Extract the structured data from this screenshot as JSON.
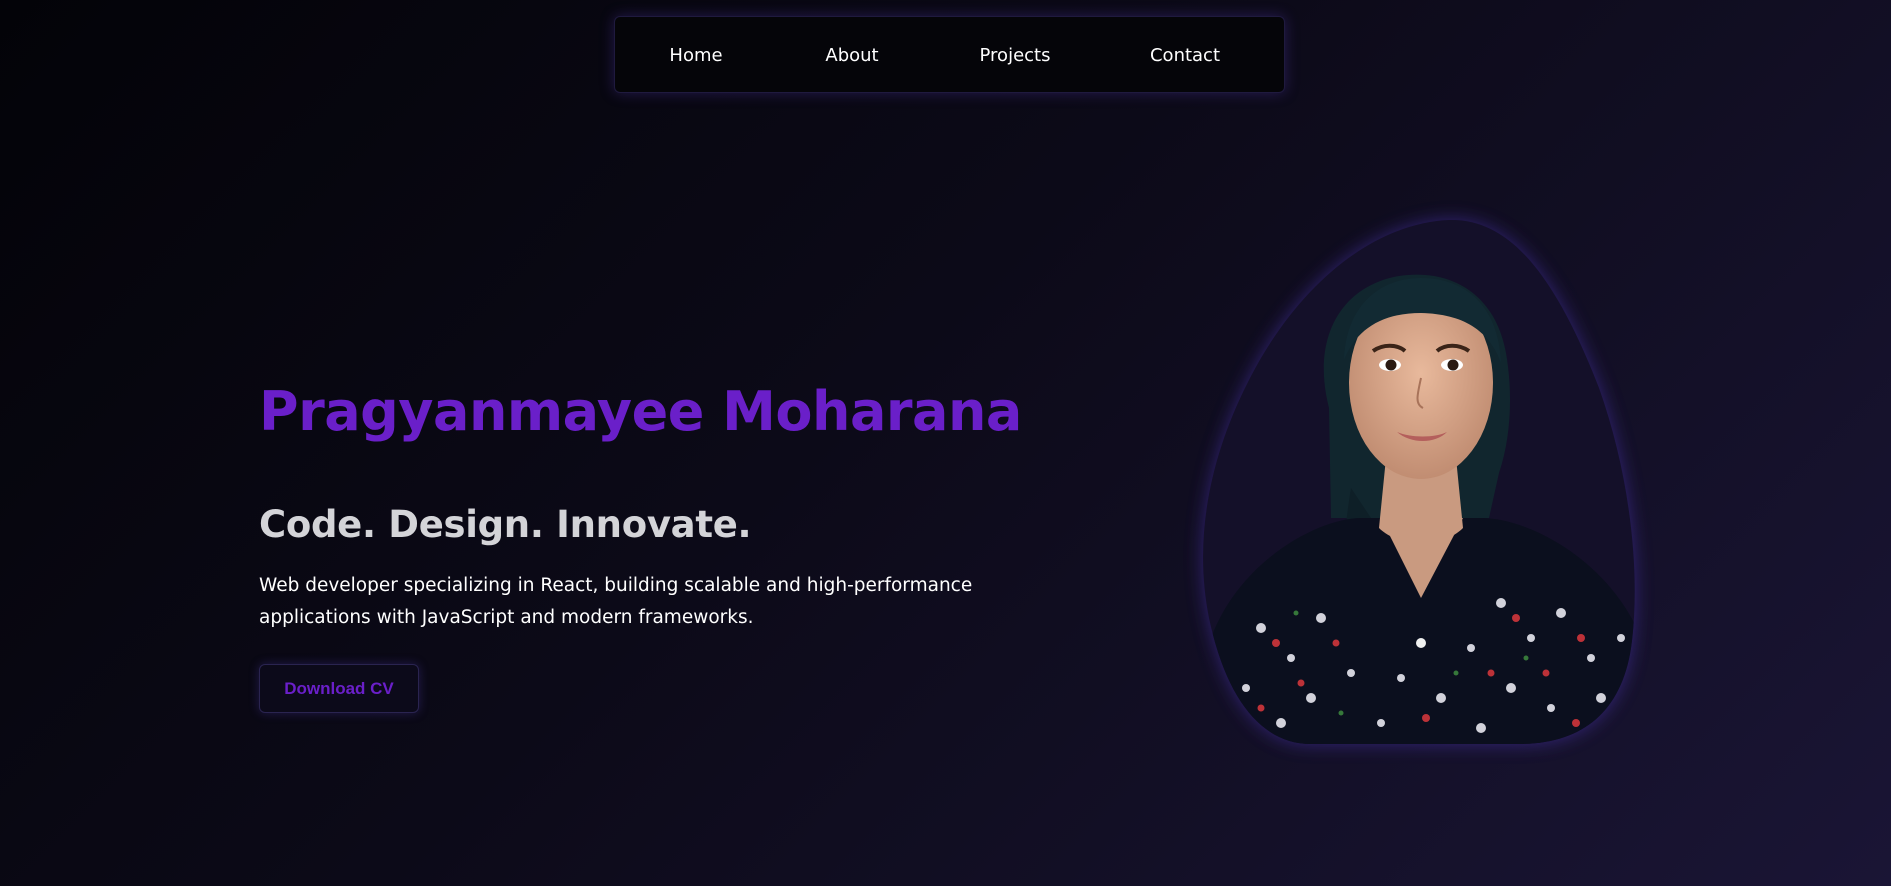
{
  "nav": {
    "items": [
      {
        "label": "Home"
      },
      {
        "label": "About"
      },
      {
        "label": "Projects"
      },
      {
        "label": "Contact"
      }
    ]
  },
  "hero": {
    "name": "Pragyanmayee Moharana",
    "tagline": "Code. Design. Innovate.",
    "description": "Web developer specializing in React, building scalable and high-performance applications with JavaScript and modern frameworks.",
    "cta_label": "Download CV"
  },
  "portrait": {
    "icon": "profile-photo"
  },
  "colors": {
    "accent": "#6a1fc9",
    "tagline": "#d4d4d8",
    "background_start": "#030308",
    "background_end": "#1a1535",
    "glow": "#5a3cbe"
  }
}
